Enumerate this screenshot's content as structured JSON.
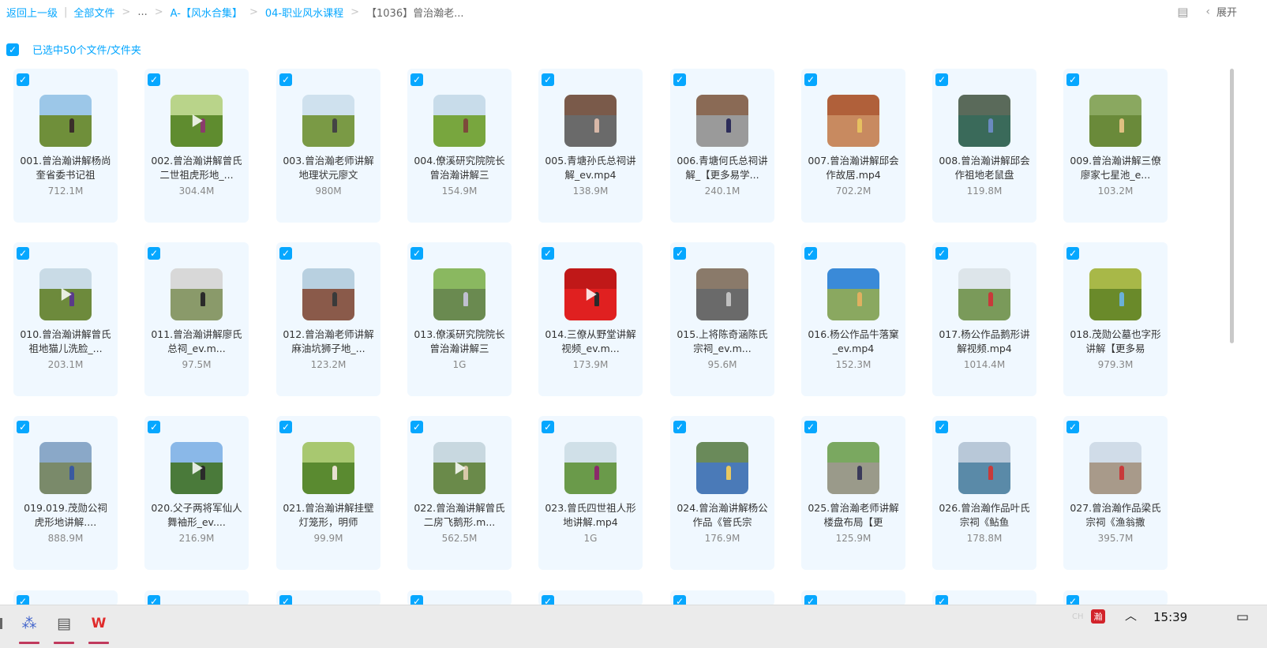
{
  "breadcrumb": {
    "back": "返回上一级",
    "all_files": "全部文件",
    "ellipsis": "...",
    "folder1": "A-【风水合集】",
    "folder2": "04-职业风水课程",
    "current": "【1036】曾治瀚老..."
  },
  "top_right": {
    "layout_icon": "list-view-icon",
    "expand_label": "展开"
  },
  "selection": {
    "label": "已选中50个文件/文件夹"
  },
  "colors": {
    "accent": "#06a7ff",
    "card_bg": "#f0f8ff"
  },
  "files": [
    {
      "name": "001.曾治瀚讲解杨尚奎省委书记祖",
      "size": "712.1M",
      "sky": "#9cc7e8",
      "ground": "#6f8f3a",
      "person": "#3a2e2a",
      "play": false
    },
    {
      "name": "002.曾治瀚讲解曾氏二世祖虎形地_...",
      "size": "304.4M",
      "sky": "#b9d48a",
      "ground": "#5f8c2f",
      "person": "#8a3b6b",
      "play": true
    },
    {
      "name": "003.曾治瀚老师讲解地理状元廖文",
      "size": "980M",
      "sky": "#cfe1ee",
      "ground": "#7a9a45",
      "person": "#444444",
      "play": false
    },
    {
      "name": "004.僚溪研究院院长曾治瀚讲解三",
      "size": "154.9M",
      "sky": "#c8dcea",
      "ground": "#78a63e",
      "person": "#7d4a3a",
      "play": false
    },
    {
      "name": "005.青塘孙氏总祠讲解_ev.mp4",
      "size": "138.9M",
      "sky": "#7a5a4a",
      "ground": "#6a6a6a",
      "person": "#d8b8a8",
      "play": false
    },
    {
      "name": "006.青塘何氏总祠讲解_【更多易学...",
      "size": "240.1M",
      "sky": "#8a6a55",
      "ground": "#9a9a9a",
      "person": "#2d2d5a",
      "play": false
    },
    {
      "name": "007.曾治瀚讲解邱会作故居.mp4",
      "size": "702.2M",
      "sky": "#b0603a",
      "ground": "#c88a60",
      "person": "#e6c060",
      "play": false
    },
    {
      "name": "008.曾治瀚讲解邱会作祖地老鼠盘",
      "size": "119.8M",
      "sky": "#5a6a5a",
      "ground": "#3a6a5a",
      "person": "#6a8ac0",
      "play": false
    },
    {
      "name": "009.曾治瀚讲解三僚廖家七星池_e...",
      "size": "103.2M",
      "sky": "#8aa860",
      "ground": "#6a8a3a",
      "person": "#e0c080",
      "play": false
    },
    {
      "name": "010.曾治瀚讲解曾氏祖地猫儿洗脸_...",
      "size": "203.1M",
      "sky": "#c9dbe6",
      "ground": "#6d8a3c",
      "person": "#5a3a8a",
      "play": true
    },
    {
      "name": "011.曾治瀚讲解廖氏总祠_ev.m...",
      "size": "97.5M",
      "sky": "#d8d8d8",
      "ground": "#8a9a6a",
      "person": "#2a2a2a",
      "play": false
    },
    {
      "name": "012.曾治瀚老师讲解麻油坑狮子地_...",
      "size": "123.2M",
      "sky": "#b8d0e0",
      "ground": "#8a5a4a",
      "person": "#3a3a3a",
      "play": false
    },
    {
      "name": "013.僚溪研究院院长曾治瀚讲解三",
      "size": "1G",
      "sky": "#8ab860",
      "ground": "#6a8a50",
      "person": "#c0c0d0",
      "play": false
    },
    {
      "name": "014.三僚从野堂讲解视频_ev.m...",
      "size": "173.9M",
      "sky": "#c01818",
      "ground": "#e02020",
      "person": "#2a2a2a",
      "play": true
    },
    {
      "name": "015.上将陈奇涵陈氏宗祠_ev.m...",
      "size": "95.6M",
      "sky": "#8a7a6a",
      "ground": "#6a6a6a",
      "person": "#c0c0c0",
      "play": false
    },
    {
      "name": "016.杨公作品牛落窠_ev.mp4",
      "size": "152.3M",
      "sky": "#3a8ad8",
      "ground": "#8aa860",
      "person": "#e0b060",
      "play": false
    },
    {
      "name": "017.杨公作品鹅形讲解视频.mp4",
      "size": "1014.4M",
      "sky": "#dde5ea",
      "ground": "#7a9a5a",
      "person": "#c83a3a",
      "play": false
    },
    {
      "name": "018.茂勋公墓也字形讲解【更多易",
      "size": "979.3M",
      "sky": "#a8b848",
      "ground": "#6a8a2a",
      "person": "#6ab0d8",
      "play": false
    },
    {
      "name": "019.019.茂勋公祠虎形地讲解....",
      "size": "888.9M",
      "sky": "#8aa8c8",
      "ground": "#7a8a6a",
      "person": "#3a5aa0",
      "play": false
    },
    {
      "name": "020.父子两将军仙人舞袖形_ev....",
      "size": "216.9M",
      "sky": "#8ab8e8",
      "ground": "#4a7a3a",
      "person": "#2a2a2a",
      "play": true
    },
    {
      "name": "021.曾治瀚讲解挂壁灯笼形，明师",
      "size": "99.9M",
      "sky": "#a8c870",
      "ground": "#5a8a30",
      "person": "#e8e0d0",
      "play": false
    },
    {
      "name": "022.曾治瀚讲解曾氏二房飞鹅形.m...",
      "size": "562.5M",
      "sky": "#c8d8e0",
      "ground": "#6a8a4a",
      "person": "#d8c8a8",
      "play": true
    },
    {
      "name": "023.曾氏四世祖人形地讲解.mp4",
      "size": "1G",
      "sky": "#d0e0e8",
      "ground": "#6a9a4a",
      "person": "#8a2a6a",
      "play": false
    },
    {
      "name": "024.曾治瀚讲解杨公作品《管氏宗",
      "size": "176.9M",
      "sky": "#6a8a5a",
      "ground": "#4a7ab8",
      "person": "#e8c860",
      "play": false
    },
    {
      "name": "025.曾治瀚老师讲解楼盘布局【更",
      "size": "125.9M",
      "sky": "#7aa860",
      "ground": "#9a9a8a",
      "person": "#3a3a5a",
      "play": false
    },
    {
      "name": "026.曾治瀚作品叶氏宗祠《鲇鱼",
      "size": "178.8M",
      "sky": "#b8c8d8",
      "ground": "#5a8aa8",
      "person": "#c83a3a",
      "play": false
    },
    {
      "name": "027.曾治瀚作品梁氏宗祠《渔翁撒",
      "size": "395.7M",
      "sky": "#d0dce8",
      "ground": "#a89a8a",
      "person": "#c83a3a",
      "play": false
    }
  ],
  "taskbar": {
    "apps": [
      {
        "icon": "network-app-icon",
        "glyph": "⁂"
      },
      {
        "icon": "notepad-app-icon",
        "glyph": "▤"
      },
      {
        "icon": "wps-app-icon",
        "glyph": "W"
      }
    ],
    "tray_lang": "CH",
    "tray_seal": "瀚",
    "clock": "15:39",
    "up_glyph": "︿",
    "notify_glyph": "▭"
  }
}
